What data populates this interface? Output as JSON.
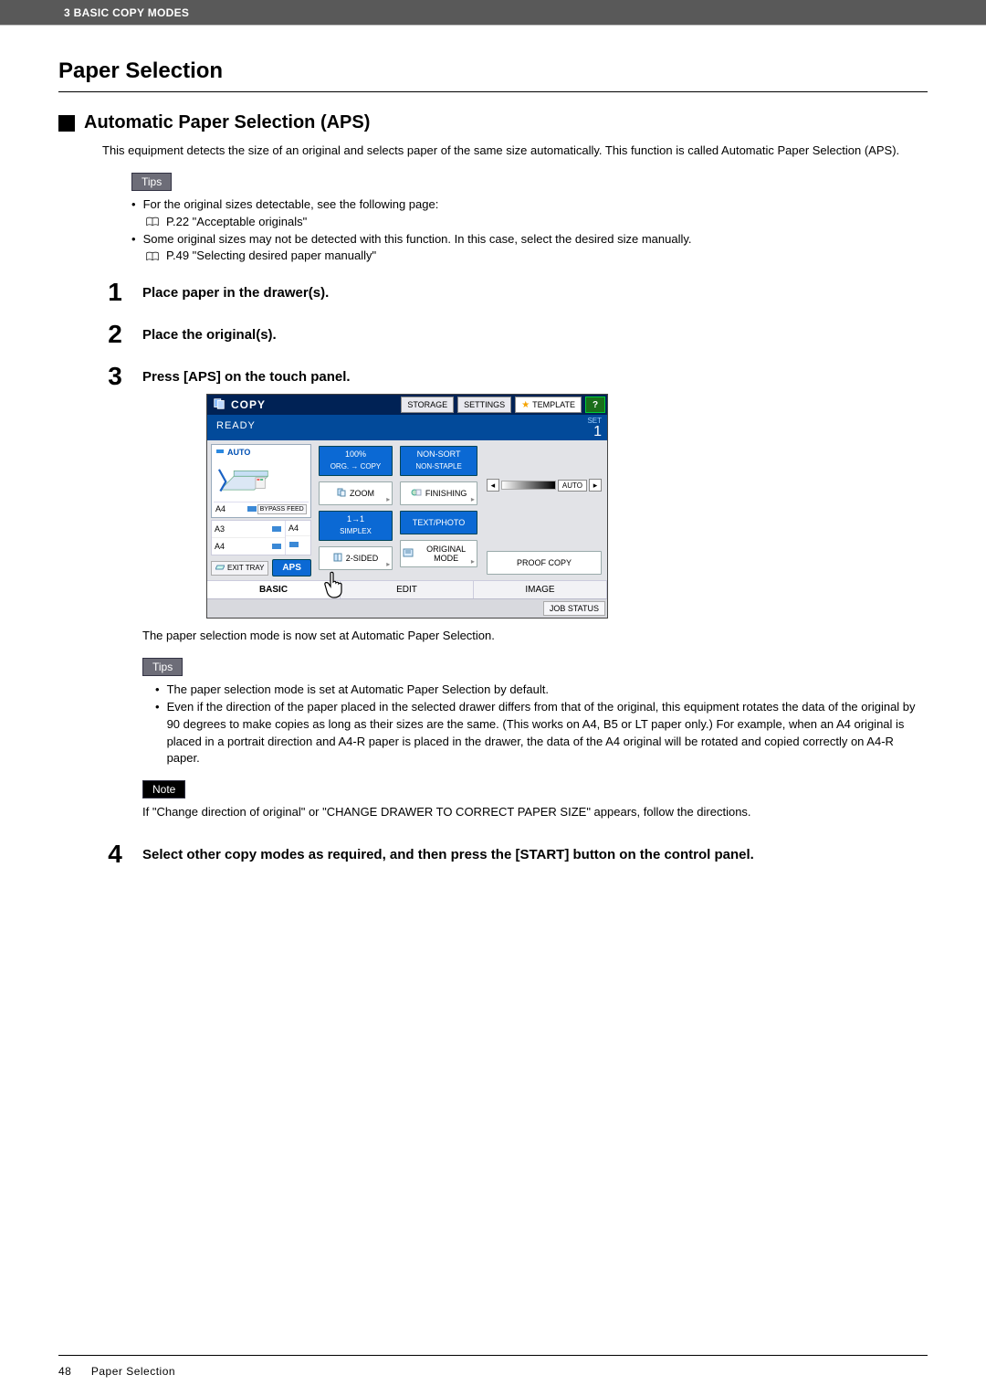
{
  "header": {
    "chapter": "3 BASIC COPY MODES"
  },
  "titles": {
    "paper_selection": "Paper Selection",
    "aps": "Automatic Paper Selection (APS)"
  },
  "intro": "This equipment detects the size of an original and selects paper of the same size automatically. This function is called Automatic Paper Selection (APS).",
  "badges": {
    "tips": "Tips",
    "note": "Note"
  },
  "tips1": {
    "b1": "For the original sizes detectable, see the following page:",
    "b1_ref": "P.22 \"Acceptable originals\"",
    "b2": "Some original sizes may not be detected with this function. In this case, select the desired size manually.",
    "b2_ref": "P.49 \"Selecting desired paper manually\""
  },
  "steps": {
    "s1": {
      "num": "1",
      "title": "Place paper in the drawer(s)."
    },
    "s2": {
      "num": "2",
      "title": "Place the original(s)."
    },
    "s3": {
      "num": "3",
      "title": "Press [APS] on the touch panel."
    },
    "s4": {
      "num": "4",
      "title": "Select other copy modes as required, and then press the [START] button on the control panel."
    }
  },
  "after_panel": "The paper selection mode is now set at Automatic Paper Selection.",
  "tips2": {
    "b1": "The paper selection mode is set at Automatic Paper Selection by default.",
    "b2": "Even if the direction of the paper placed in the selected drawer differs from that of the original, this equipment rotates the data of the original by 90 degrees to make copies as long as their sizes are the same. (This works on A4, B5 or LT paper only.) For example, when an A4 original is placed in a portrait direction and A4-R paper is placed in the drawer, the data of the A4 original will be rotated and copied correctly on A4-R paper."
  },
  "note_text": "If \"Change direction of original\" or \"CHANGE DRAWER TO CORRECT PAPER SIZE\" appears, follow the directions.",
  "panel": {
    "title": "COPY",
    "storage": "STORAGE",
    "settings": "SETTINGS",
    "template": "TEMPLATE",
    "help": "?",
    "ready": "READY",
    "set_label": "SET",
    "set_value": "1",
    "auto_label": "AUTO",
    "bypass": "BYPASS FEED",
    "trays": {
      "a4_1": "A4",
      "a3": "A3",
      "a4_2": "A4",
      "a4_3": "A4"
    },
    "exit_tray": "EXIT TRAY",
    "aps_btn": "APS",
    "ratio_top": "100%",
    "ratio_sub": "ORG.  → COPY",
    "zoom": "ZOOM",
    "simplex_top": "1→1",
    "simplex_sub": "SIMPLEX",
    "two_sided": "2-SIDED",
    "nonsort_top": "NON-SORT",
    "nonsort_sub": "NON-STAPLE",
    "finishing": "FINISHING",
    "text_photo": "TEXT/PHOTO",
    "original_mode": "ORIGINAL MODE",
    "density_auto": "AUTO",
    "proof": "PROOF COPY",
    "tabs": {
      "basic": "BASIC",
      "edit": "EDIT",
      "image": "IMAGE"
    },
    "job_status": "JOB STATUS"
  },
  "footer": {
    "page": "48",
    "title": "Paper Selection"
  }
}
